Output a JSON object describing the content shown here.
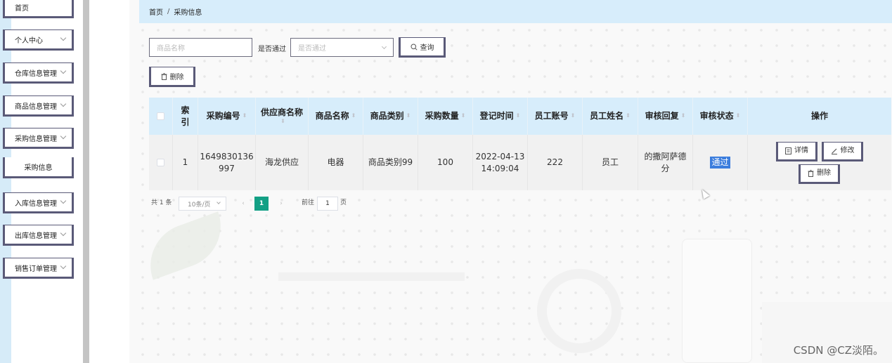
{
  "sidebar": {
    "items": [
      {
        "label": "首页",
        "has_chevron": false
      },
      {
        "label": "个人中心",
        "has_chevron": true
      },
      {
        "label": "仓库信息管理",
        "has_chevron": true
      },
      {
        "label": "商品信息管理",
        "has_chevron": true
      },
      {
        "label": "采购信息管理",
        "has_chevron": true
      },
      {
        "label": "采购信息",
        "has_chevron": false
      },
      {
        "label": "入库信息管理",
        "has_chevron": true
      },
      {
        "label": "出库信息管理",
        "has_chevron": true
      },
      {
        "label": "销售订单管理",
        "has_chevron": true
      }
    ]
  },
  "breadcrumb": {
    "home": "首页",
    "separator": "/",
    "current": "采购信息"
  },
  "search": {
    "product_placeholder": "商品名称",
    "passed_label": "是否通过",
    "passed_placeholder": "是否通过",
    "query_button": "查询",
    "delete_button": "删除"
  },
  "table": {
    "headers": {
      "index": "索\n引",
      "purchase_no": "采购编号",
      "supplier": "供应商名称",
      "product_name": "商品名称",
      "category": "商品类别",
      "quantity": "采购数量",
      "reg_time": "登记时间",
      "emp_account": "员工账号",
      "emp_name": "员工姓名",
      "review_reply": "审核回复",
      "review_status": "审核状态",
      "actions": "操作"
    },
    "rows": [
      {
        "index": "1",
        "purchase_no": "1649830136\n997",
        "supplier": "海龙供应",
        "product_name": "电器",
        "category": "商品类别99",
        "quantity": "100",
        "reg_time": "2022-04-13\n14:09:04",
        "emp_account": "222",
        "emp_name": "员工",
        "review_reply": "的撒阿萨德\n分",
        "review_status": "通过",
        "detail_button": "详情",
        "edit_button": "修改",
        "delete_button": "删除"
      }
    ]
  },
  "pagination": {
    "total": "共 1 条",
    "page_size": "10条/页",
    "current_page": "1",
    "goto_label": "前往",
    "goto_value": "1",
    "page_suffix": "页"
  },
  "watermark": "CSDN @CZ淡陌。",
  "colors": {
    "accent": "#13a085",
    "header_bg": "#d7edfb",
    "status_highlight": "#3b7ddd"
  }
}
